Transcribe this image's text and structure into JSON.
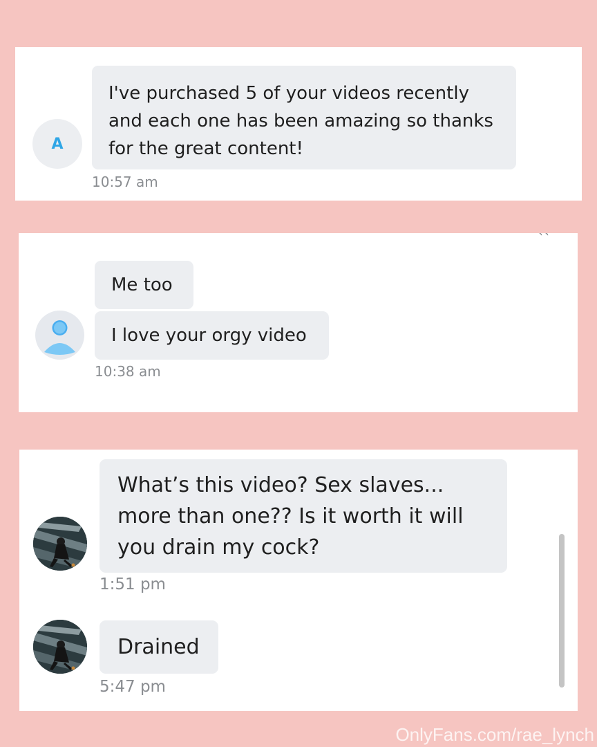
{
  "colors": {
    "background": "#f6c5c1",
    "panel": "#ffffff",
    "bubble": "#eceef1",
    "timestamp": "#8a8d91",
    "accent": "#2fa6e6"
  },
  "panel1": {
    "avatar_letter": "A",
    "message": "I've purchased 5 of your videos recently and each one has been amazing so thanks for the great content!",
    "time": "10:57 am"
  },
  "panel2": {
    "avatar_icon": "user-placeholder-icon",
    "messages": [
      "Me too",
      "I love your orgy video"
    ],
    "time": "10:38 am"
  },
  "panel3": {
    "avatar_icon": "profile-photo",
    "messages": [
      {
        "text": "What’s this video? Sex slaves... more than one?? Is it worth it will you drain my cock?",
        "time": "1:51 pm"
      },
      {
        "text": "Drained",
        "time": "5:47 pm"
      }
    ]
  },
  "watermark": "OnlyFans.com/rae_lynch"
}
